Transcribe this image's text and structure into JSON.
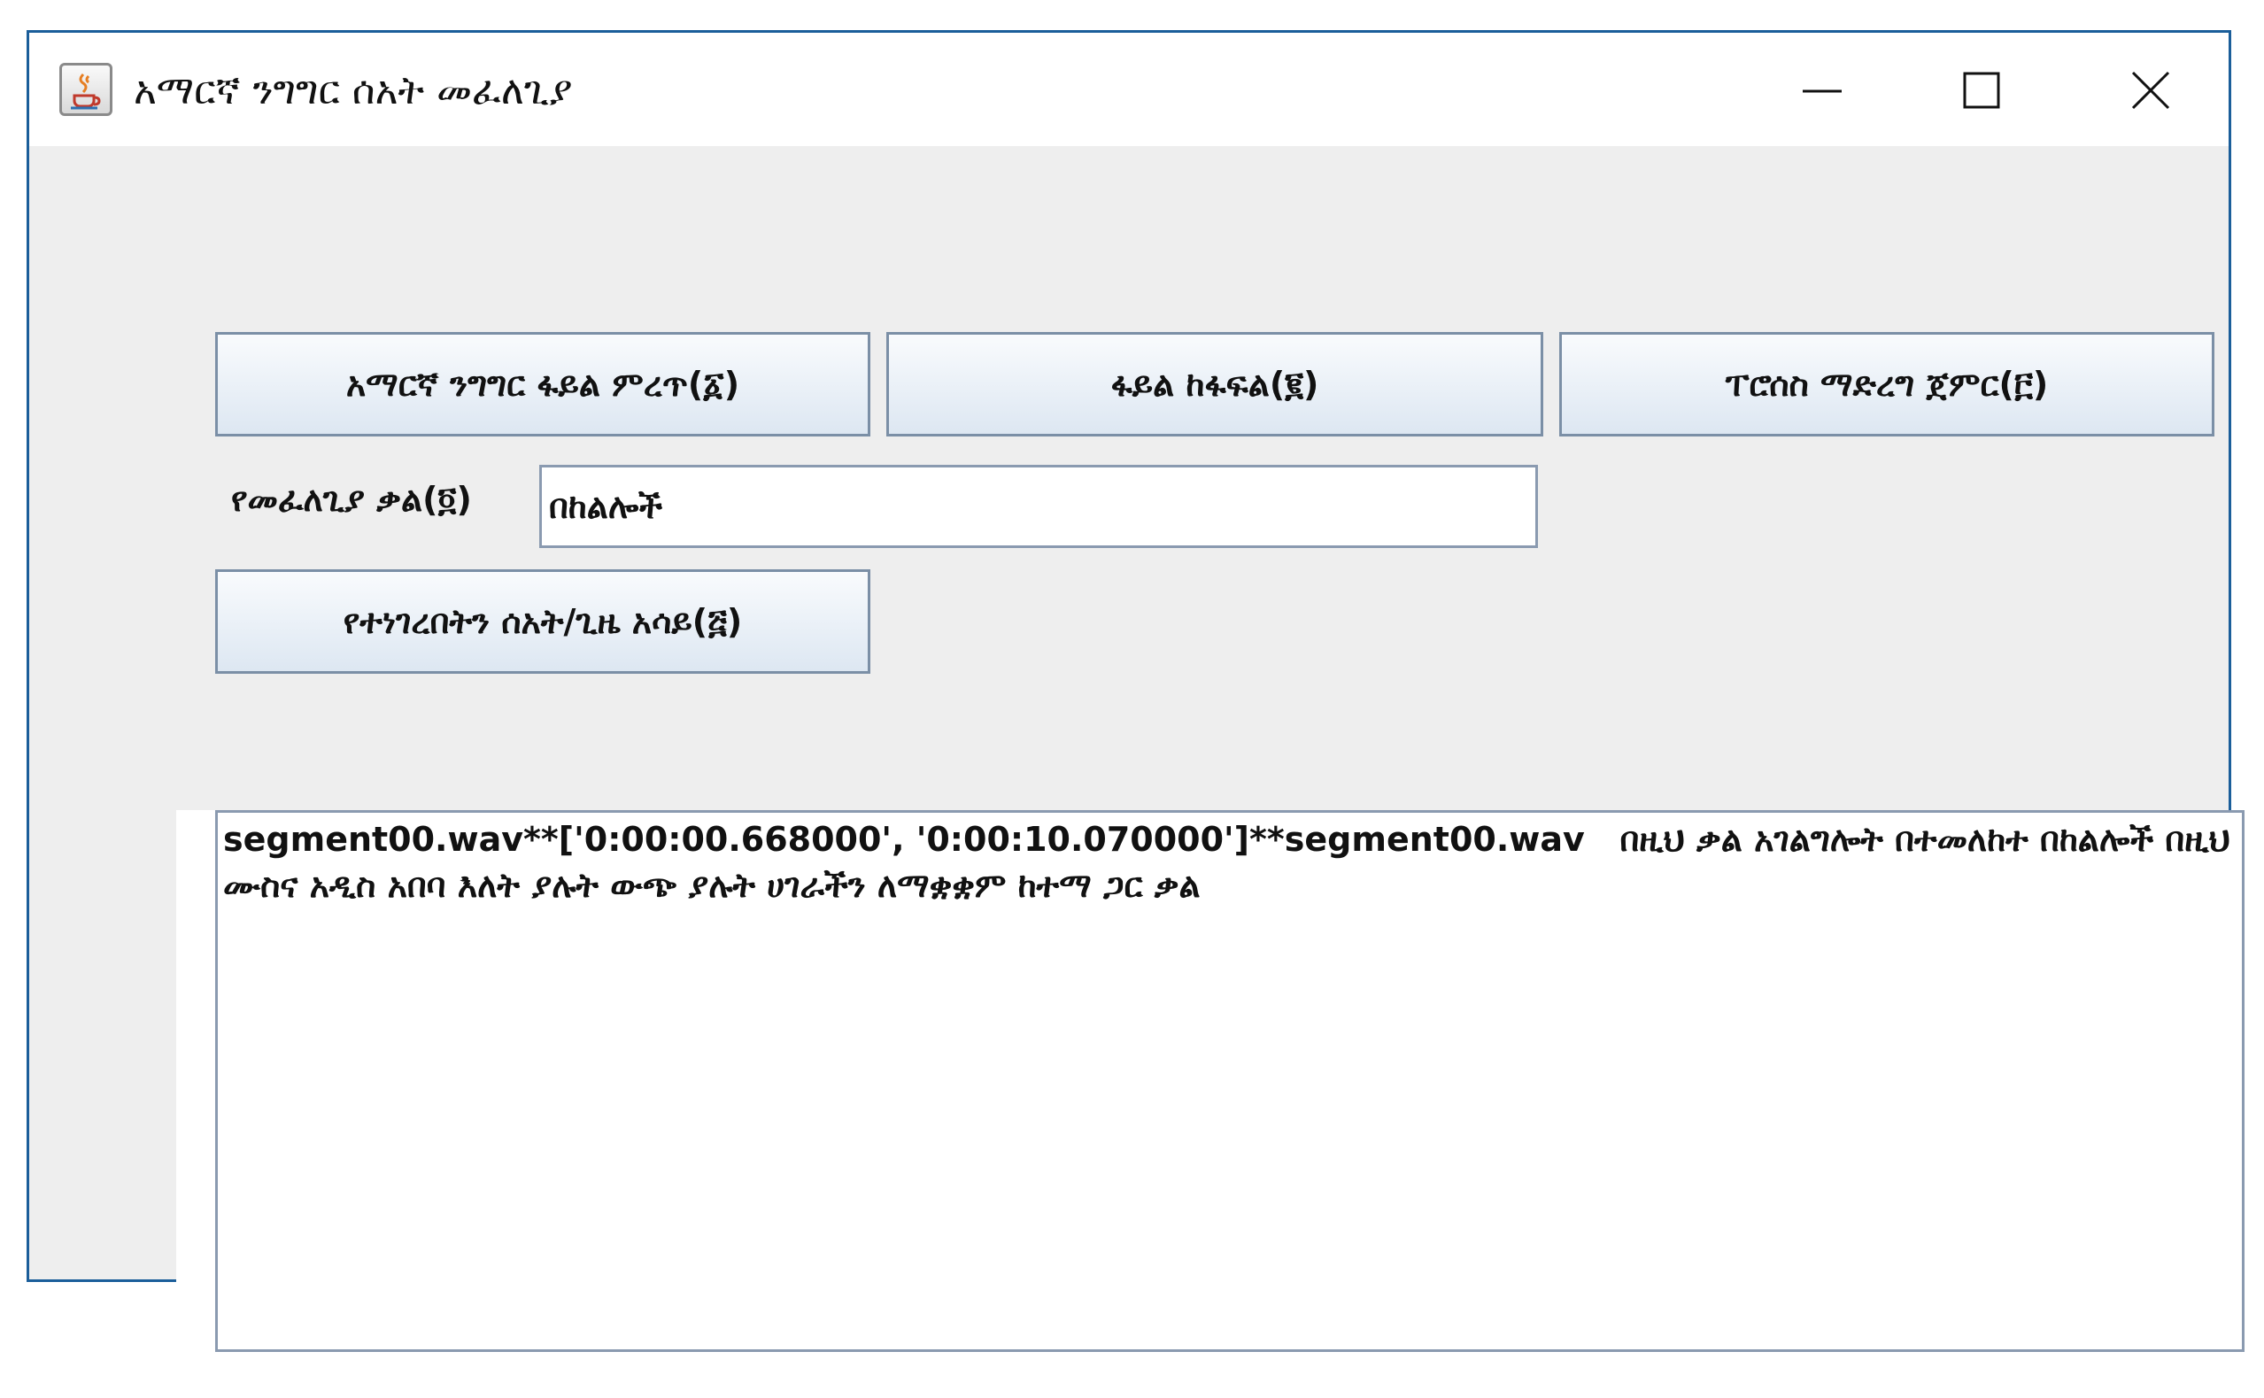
{
  "window": {
    "title": "አማርኛ ንግግር ሰአት መፈለጊያ",
    "icon": "java-cup-icon"
  },
  "controls": {
    "minimize_icon": "minimize-icon",
    "maximize_icon": "maximize-icon",
    "close_icon": "close-icon"
  },
  "buttons": {
    "choose_file": "አማርኛ ንግግር ፋይል ምረጥ(፩)",
    "split_file": "ፋይል ከፋፍል(፪)",
    "start_processing": "ፐሮሰስ ማድረግ ጀምር(፫)",
    "show_time": "የተነገረበትን ሰአት/ጊዜ አሳይ(፭)"
  },
  "search": {
    "label": "የመፈለጊያ ቃል(፬)",
    "value": "በከልሎች"
  },
  "result": {
    "text": "segment00.wav**['0:00:00.668000', '0:00:10.070000']**segment00.wav   በዚህ ቃል አገልግሎት በተመለከተ በከልሎች በዚህ ሙስና አዲስ አበባ እለት ያሉት ውጭ ያሉት ሀገራችን ለማቋቋም ከተማ ጋር ቃል"
  },
  "colors": {
    "window_border": "#1b5e9a",
    "panel_background": "#eeeeee",
    "button_top": "#f9fbfd",
    "button_bottom": "#dde7f2",
    "button_border": "#7b8fa6"
  }
}
